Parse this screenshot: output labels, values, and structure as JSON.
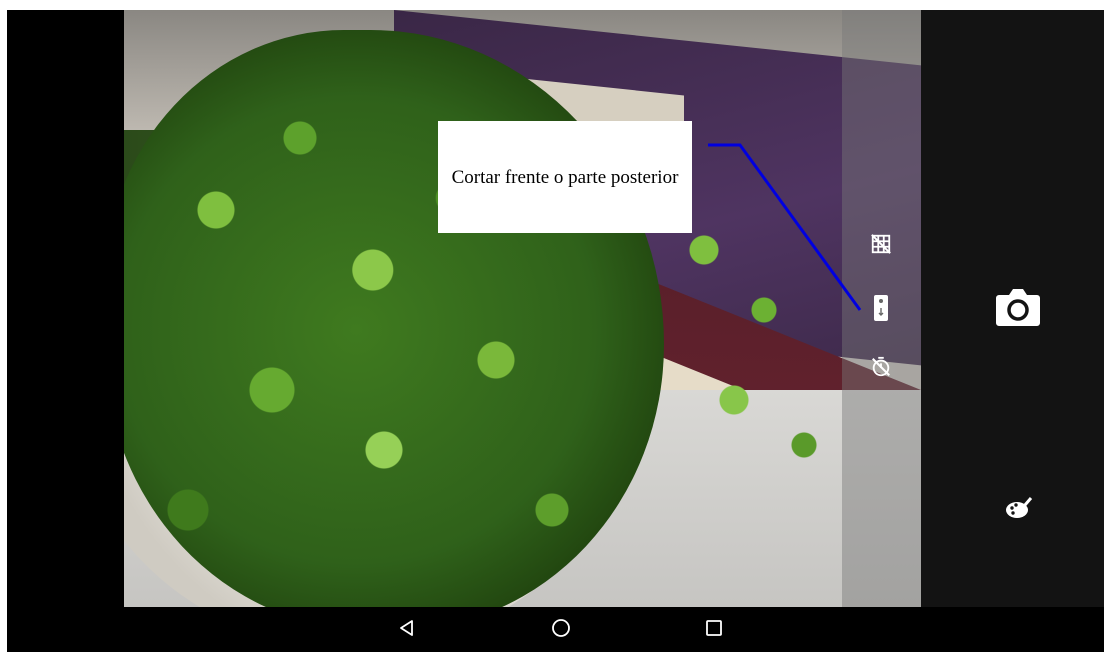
{
  "callout": {
    "text": "Cortar frente o parte posterior"
  },
  "quick_settings": {
    "items": [
      {
        "icon": "grid-off-icon"
      },
      {
        "icon": "switch-camera-icon"
      },
      {
        "icon": "timer-off-icon"
      }
    ]
  },
  "side_panel": {
    "shutter_icon": "camera-icon",
    "effects_icon": "palette-icon"
  },
  "nav_bar": {
    "back_icon": "back-triangle-icon",
    "home_icon": "home-circle-icon",
    "recents_icon": "recents-square-icon"
  },
  "colors": {
    "leader_line": "#0000e0",
    "panel": "#131313",
    "navbar": "#000000"
  }
}
